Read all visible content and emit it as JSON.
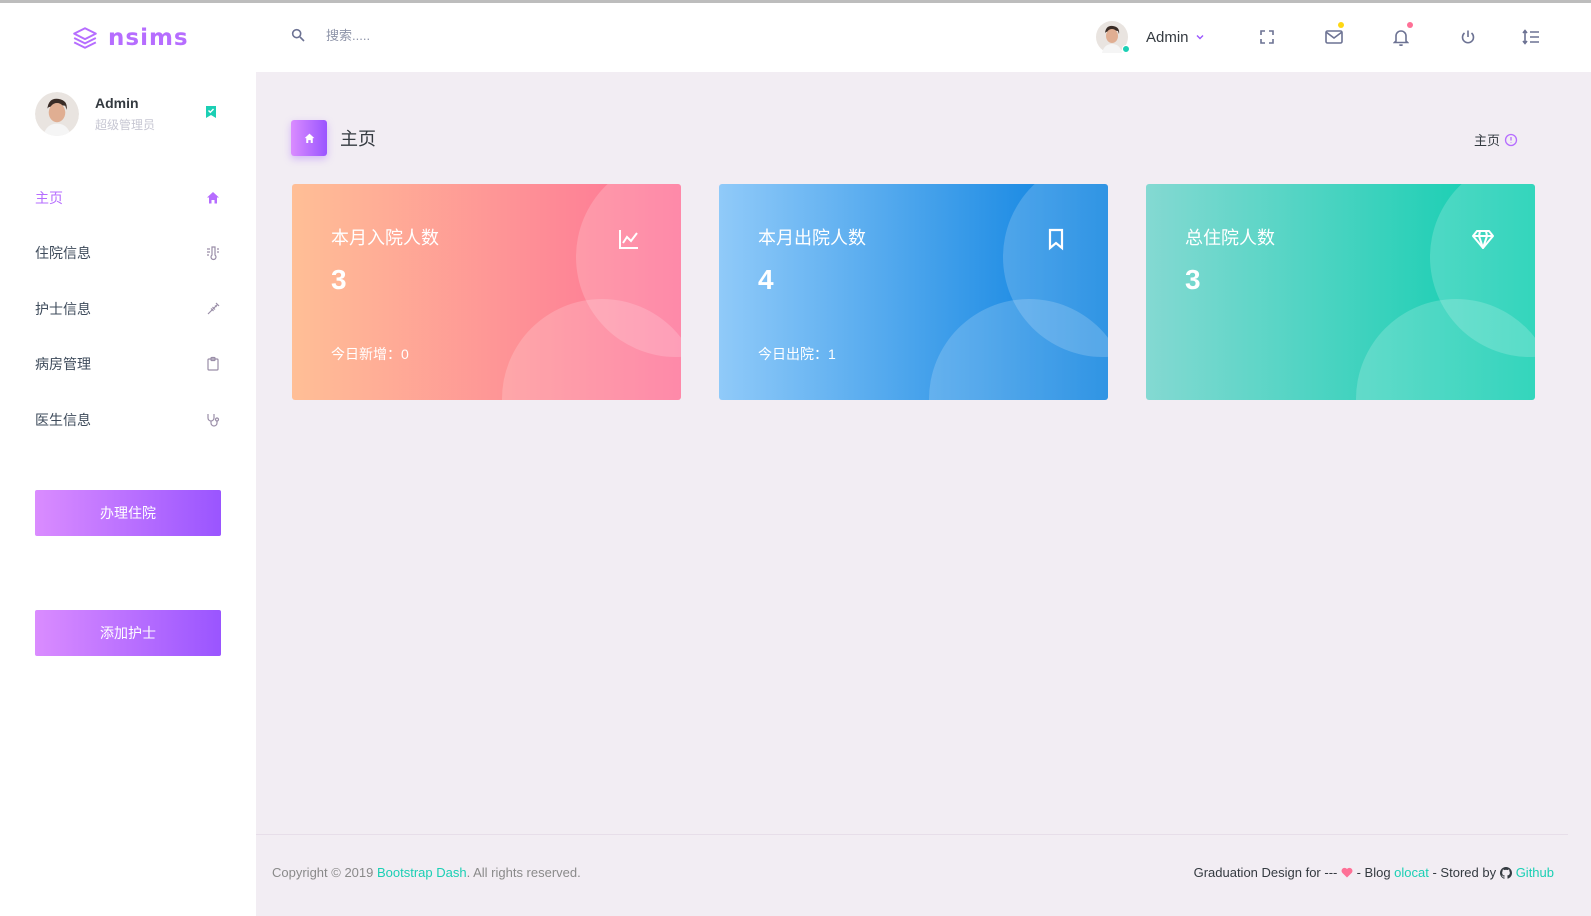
{
  "brand": {
    "name": "nsims"
  },
  "search": {
    "placeholder": "搜索....."
  },
  "header_user": {
    "name": "Admin"
  },
  "colors": {
    "primary": "#b66dff",
    "success": "#1bcfb4",
    "danger": "#fe7096",
    "info": "#198ae3",
    "warning": "#fed713"
  },
  "sidebar": {
    "profile": {
      "name": "Admin",
      "role": "超级管理员"
    },
    "items": [
      {
        "label": "主页",
        "icon": "home-icon",
        "active": true
      },
      {
        "label": "住院信息",
        "icon": "thermometer-icon",
        "active": false
      },
      {
        "label": "护士信息",
        "icon": "syringe-icon",
        "active": false
      },
      {
        "label": "病房管理",
        "icon": "clipboard-icon",
        "active": false
      },
      {
        "label": "医生信息",
        "icon": "stethoscope-icon",
        "active": false
      }
    ],
    "buttons": {
      "admit": "办理住院",
      "add_nurse": "添加护士"
    }
  },
  "page": {
    "title": "主页",
    "breadcrumb": "主页"
  },
  "cards": [
    {
      "title": "本月入院人数",
      "value": "3",
      "footer": "今日新增：0",
      "icon": "chart-line-icon"
    },
    {
      "title": "本月出院人数",
      "value": "4",
      "footer": "今日出院：1",
      "icon": "bookmark-icon"
    },
    {
      "title": "总住院人数",
      "value": "3",
      "footer": "",
      "icon": "diamond-icon"
    }
  ],
  "footer": {
    "copyright_prefix": "Copyright © 2019 ",
    "copyright_link": "Bootstrap Dash",
    "copyright_suffix": ". All rights reserved.",
    "design_prefix": "Graduation Design for --- ",
    "blog_prefix": " - Blog ",
    "blog_link": "olocat",
    "stored_prefix": " - Stored by ",
    "github_link": "Github"
  }
}
